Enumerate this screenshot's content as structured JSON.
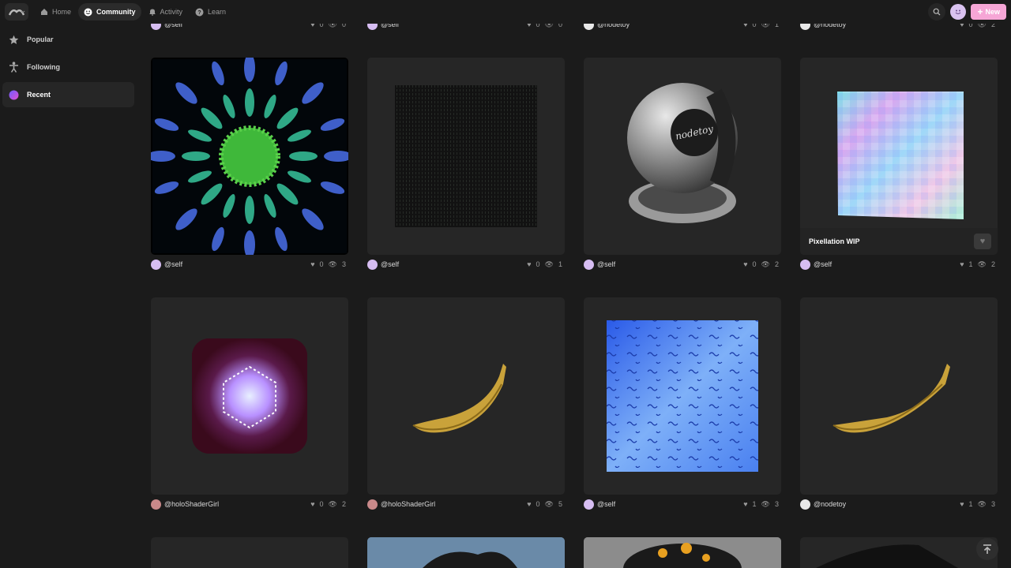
{
  "nav": {
    "home": "Home",
    "community": "Community",
    "activity": "Activity",
    "learn": "Learn",
    "new_label": "New"
  },
  "sidebar": {
    "items": [
      {
        "label": "Popular",
        "icon": "star-icon"
      },
      {
        "label": "Following",
        "icon": "person-icon"
      },
      {
        "label": "Recent",
        "icon": "recent-icon"
      }
    ]
  },
  "top_row_meta": [
    {
      "user": "@self",
      "likes": "0",
      "views": "0"
    },
    {
      "user": "@self",
      "likes": "0",
      "views": "0"
    },
    {
      "user": "@nodetoy",
      "likes": "0",
      "views": "1"
    },
    {
      "user": "@nodetoy",
      "likes": "0",
      "views": "2"
    }
  ],
  "row1": [
    {
      "user": "@self",
      "likes": "0",
      "views": "3"
    },
    {
      "user": "@self",
      "likes": "0",
      "views": "1"
    },
    {
      "user": "@self",
      "likes": "0",
      "views": "2"
    },
    {
      "user": "@self",
      "likes": "1",
      "views": "2",
      "title": "Pixellation WIP"
    }
  ],
  "row2": [
    {
      "user": "@holoShaderGirl",
      "likes": "0",
      "views": "2"
    },
    {
      "user": "@holoShaderGirl",
      "likes": "0",
      "views": "5"
    },
    {
      "user": "@self",
      "likes": "1",
      "views": "3"
    },
    {
      "user": "@nodetoy",
      "likes": "1",
      "views": "3"
    }
  ],
  "colors": {
    "accent": "#f6a6d6",
    "background": "#1b1b1b",
    "card": "#262626"
  }
}
